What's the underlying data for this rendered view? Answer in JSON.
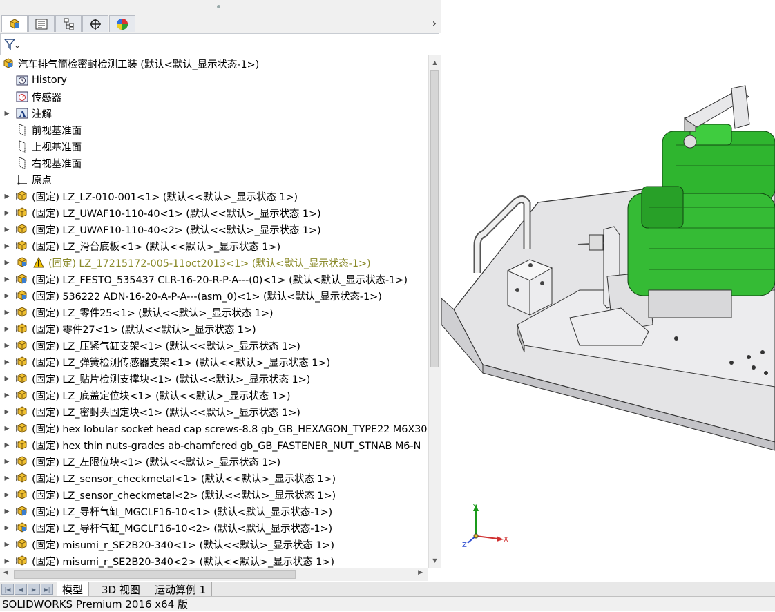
{
  "tabs": [
    {
      "name": "feature-manager",
      "icon": "feature-manager-icon"
    },
    {
      "name": "property-manager",
      "icon": "property-manager-icon"
    },
    {
      "name": "configuration-manager",
      "icon": "configuration-manager-icon"
    },
    {
      "name": "dimxpert-manager",
      "icon": "dimxpert-icon"
    },
    {
      "name": "display-manager",
      "icon": "display-manager-icon"
    }
  ],
  "tree": {
    "root_label": "汽车排气筒检密封检测工装 (默认<默认_显示状态-1>)",
    "items": [
      {
        "label": "History",
        "icon": "history-icon",
        "expand": false
      },
      {
        "label": "传感器",
        "icon": "sensor-icon",
        "expand": false
      },
      {
        "label": "注解",
        "icon": "annotation-icon",
        "expand": true
      },
      {
        "label": "前视基准面",
        "icon": "plane-icon",
        "expand": false
      },
      {
        "label": "上视基准面",
        "icon": "plane-icon",
        "expand": false
      },
      {
        "label": "右视基准面",
        "icon": "plane-icon",
        "expand": false
      },
      {
        "label": "原点",
        "icon": "origin-icon",
        "expand": false
      },
      {
        "label": "(固定) LZ_LZ-010-001<1> (默认<<默认>_显示状态 1>)",
        "icon": "part-icon",
        "expand": true
      },
      {
        "label": "(固定) LZ_UWAF10-110-40<1> (默认<<默认>_显示状态 1>)",
        "icon": "part-icon",
        "expand": true
      },
      {
        "label": "(固定) LZ_UWAF10-110-40<2> (默认<<默认>_显示状态 1>)",
        "icon": "part-icon",
        "expand": true
      },
      {
        "label": "(固定) LZ_滑台底板<1> (默认<<默认>_显示状态 1>)",
        "icon": "part-icon",
        "expand": true
      },
      {
        "label": "(固定) LZ_17215172-005-11oct2013<1> (默认<默认_显示状态-1>)",
        "icon": "assembly-warning-icon",
        "expand": true,
        "warn": true
      },
      {
        "label": "(固定) LZ_FESTO_535437 CLR-16-20-R-P-A---(0)<1> (默认<默认_显示状态-1>)",
        "icon": "assembly-icon",
        "expand": true
      },
      {
        "label": "(固定) 536222 ADN-16-20-A-P-A---(asm_0)<1> (默认<默认_显示状态-1>)",
        "icon": "assembly-icon",
        "expand": true
      },
      {
        "label": "(固定) LZ_零件25<1> (默认<<默认>_显示状态 1>)",
        "icon": "part-icon",
        "expand": true
      },
      {
        "label": "(固定) 零件27<1> (默认<<默认>_显示状态 1>)",
        "icon": "part-icon",
        "expand": true
      },
      {
        "label": "(固定) LZ_压紧气缸支架<1> (默认<<默认>_显示状态 1>)",
        "icon": "part-icon",
        "expand": true
      },
      {
        "label": "(固定) LZ_弹簧检测传感器支架<1> (默认<<默认>_显示状态 1>)",
        "icon": "part-icon",
        "expand": true
      },
      {
        "label": "(固定) LZ_贴片检测支撑块<1> (默认<<默认>_显示状态 1>)",
        "icon": "part-icon",
        "expand": true
      },
      {
        "label": "(固定) LZ_底盖定位块<1> (默认<<默认>_显示状态 1>)",
        "icon": "part-icon",
        "expand": true
      },
      {
        "label": "(固定) LZ_密封头固定块<1> (默认<<默认>_显示状态 1>)",
        "icon": "part-icon",
        "expand": true
      },
      {
        "label": "(固定) hex lobular socket head cap screws-8.8 gb_GB_HEXAGON_TYPE22 M6X30",
        "icon": "part-icon",
        "expand": true
      },
      {
        "label": "(固定) hex thin nuts-grades ab-chamfered gb_GB_FASTENER_NUT_STNAB M6-N",
        "icon": "part-icon",
        "expand": true
      },
      {
        "label": "(固定) LZ_左限位块<1> (默认<<默认>_显示状态 1>)",
        "icon": "part-icon",
        "expand": true
      },
      {
        "label": "(固定) LZ_sensor_checkmetal<1> (默认<<默认>_显示状态 1>)",
        "icon": "part-icon",
        "expand": true
      },
      {
        "label": "(固定) LZ_sensor_checkmetal<2> (默认<<默认>_显示状态 1>)",
        "icon": "part-icon",
        "expand": true
      },
      {
        "label": "(固定) LZ_导杆气缸_MGCLF16-10<1> (默认<默认_显示状态-1>)",
        "icon": "assembly-icon",
        "expand": true
      },
      {
        "label": "(固定) LZ_导杆气缸_MGCLF16-10<2> (默认<默认_显示状态-1>)",
        "icon": "assembly-icon",
        "expand": true
      },
      {
        "label": "(固定) misumi_r_SE2B20-340<1> (默认<<默认>_显示状态 1>)",
        "icon": "part-icon",
        "expand": true
      },
      {
        "label": "(固定) misumi_r_SE2B20-340<2> (默认<<默认>_显示状态 1>)",
        "icon": "part-icon",
        "expand": true
      }
    ]
  },
  "bottom_tabs": [
    {
      "label": "模型",
      "active": true
    },
    {
      "label": "3D 视图",
      "active": false
    },
    {
      "label": "运动算例 1",
      "active": false
    }
  ],
  "triad": {
    "x": "X",
    "y": "Y",
    "z": "Z"
  },
  "status": {
    "text": "SOLIDWORKS Premium 2016 x64 版"
  },
  "colors": {
    "accent_green": "#2fb52f",
    "plate_gray": "#e4e4e6",
    "part_yellow": "#f0c030",
    "assembly_blue": "#3b7fd0"
  }
}
